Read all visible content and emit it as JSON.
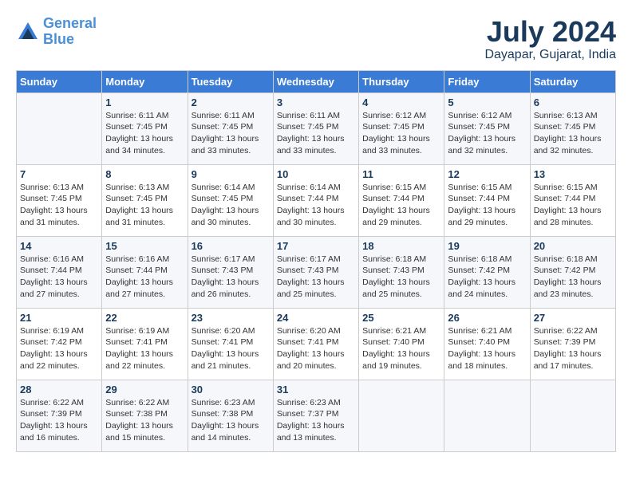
{
  "logo": {
    "line1": "General",
    "line2": "Blue"
  },
  "title": "July 2024",
  "location": "Dayapar, Gujarat, India",
  "days_of_week": [
    "Sunday",
    "Monday",
    "Tuesday",
    "Wednesday",
    "Thursday",
    "Friday",
    "Saturday"
  ],
  "weeks": [
    [
      {
        "day": "",
        "sunrise": "",
        "sunset": "",
        "daylight": ""
      },
      {
        "day": "1",
        "sunrise": "Sunrise: 6:11 AM",
        "sunset": "Sunset: 7:45 PM",
        "daylight": "Daylight: 13 hours and 34 minutes."
      },
      {
        "day": "2",
        "sunrise": "Sunrise: 6:11 AM",
        "sunset": "Sunset: 7:45 PM",
        "daylight": "Daylight: 13 hours and 33 minutes."
      },
      {
        "day": "3",
        "sunrise": "Sunrise: 6:11 AM",
        "sunset": "Sunset: 7:45 PM",
        "daylight": "Daylight: 13 hours and 33 minutes."
      },
      {
        "day": "4",
        "sunrise": "Sunrise: 6:12 AM",
        "sunset": "Sunset: 7:45 PM",
        "daylight": "Daylight: 13 hours and 33 minutes."
      },
      {
        "day": "5",
        "sunrise": "Sunrise: 6:12 AM",
        "sunset": "Sunset: 7:45 PM",
        "daylight": "Daylight: 13 hours and 32 minutes."
      },
      {
        "day": "6",
        "sunrise": "Sunrise: 6:13 AM",
        "sunset": "Sunset: 7:45 PM",
        "daylight": "Daylight: 13 hours and 32 minutes."
      }
    ],
    [
      {
        "day": "7",
        "sunrise": "Sunrise: 6:13 AM",
        "sunset": "Sunset: 7:45 PM",
        "daylight": "Daylight: 13 hours and 31 minutes."
      },
      {
        "day": "8",
        "sunrise": "Sunrise: 6:13 AM",
        "sunset": "Sunset: 7:45 PM",
        "daylight": "Daylight: 13 hours and 31 minutes."
      },
      {
        "day": "9",
        "sunrise": "Sunrise: 6:14 AM",
        "sunset": "Sunset: 7:45 PM",
        "daylight": "Daylight: 13 hours and 30 minutes."
      },
      {
        "day": "10",
        "sunrise": "Sunrise: 6:14 AM",
        "sunset": "Sunset: 7:44 PM",
        "daylight": "Daylight: 13 hours and 30 minutes."
      },
      {
        "day": "11",
        "sunrise": "Sunrise: 6:15 AM",
        "sunset": "Sunset: 7:44 PM",
        "daylight": "Daylight: 13 hours and 29 minutes."
      },
      {
        "day": "12",
        "sunrise": "Sunrise: 6:15 AM",
        "sunset": "Sunset: 7:44 PM",
        "daylight": "Daylight: 13 hours and 29 minutes."
      },
      {
        "day": "13",
        "sunrise": "Sunrise: 6:15 AM",
        "sunset": "Sunset: 7:44 PM",
        "daylight": "Daylight: 13 hours and 28 minutes."
      }
    ],
    [
      {
        "day": "14",
        "sunrise": "Sunrise: 6:16 AM",
        "sunset": "Sunset: 7:44 PM",
        "daylight": "Daylight: 13 hours and 27 minutes."
      },
      {
        "day": "15",
        "sunrise": "Sunrise: 6:16 AM",
        "sunset": "Sunset: 7:44 PM",
        "daylight": "Daylight: 13 hours and 27 minutes."
      },
      {
        "day": "16",
        "sunrise": "Sunrise: 6:17 AM",
        "sunset": "Sunset: 7:43 PM",
        "daylight": "Daylight: 13 hours and 26 minutes."
      },
      {
        "day": "17",
        "sunrise": "Sunrise: 6:17 AM",
        "sunset": "Sunset: 7:43 PM",
        "daylight": "Daylight: 13 hours and 25 minutes."
      },
      {
        "day": "18",
        "sunrise": "Sunrise: 6:18 AM",
        "sunset": "Sunset: 7:43 PM",
        "daylight": "Daylight: 13 hours and 25 minutes."
      },
      {
        "day": "19",
        "sunrise": "Sunrise: 6:18 AM",
        "sunset": "Sunset: 7:42 PM",
        "daylight": "Daylight: 13 hours and 24 minutes."
      },
      {
        "day": "20",
        "sunrise": "Sunrise: 6:18 AM",
        "sunset": "Sunset: 7:42 PM",
        "daylight": "Daylight: 13 hours and 23 minutes."
      }
    ],
    [
      {
        "day": "21",
        "sunrise": "Sunrise: 6:19 AM",
        "sunset": "Sunset: 7:42 PM",
        "daylight": "Daylight: 13 hours and 22 minutes."
      },
      {
        "day": "22",
        "sunrise": "Sunrise: 6:19 AM",
        "sunset": "Sunset: 7:41 PM",
        "daylight": "Daylight: 13 hours and 22 minutes."
      },
      {
        "day": "23",
        "sunrise": "Sunrise: 6:20 AM",
        "sunset": "Sunset: 7:41 PM",
        "daylight": "Daylight: 13 hours and 21 minutes."
      },
      {
        "day": "24",
        "sunrise": "Sunrise: 6:20 AM",
        "sunset": "Sunset: 7:41 PM",
        "daylight": "Daylight: 13 hours and 20 minutes."
      },
      {
        "day": "25",
        "sunrise": "Sunrise: 6:21 AM",
        "sunset": "Sunset: 7:40 PM",
        "daylight": "Daylight: 13 hours and 19 minutes."
      },
      {
        "day": "26",
        "sunrise": "Sunrise: 6:21 AM",
        "sunset": "Sunset: 7:40 PM",
        "daylight": "Daylight: 13 hours and 18 minutes."
      },
      {
        "day": "27",
        "sunrise": "Sunrise: 6:22 AM",
        "sunset": "Sunset: 7:39 PM",
        "daylight": "Daylight: 13 hours and 17 minutes."
      }
    ],
    [
      {
        "day": "28",
        "sunrise": "Sunrise: 6:22 AM",
        "sunset": "Sunset: 7:39 PM",
        "daylight": "Daylight: 13 hours and 16 minutes."
      },
      {
        "day": "29",
        "sunrise": "Sunrise: 6:22 AM",
        "sunset": "Sunset: 7:38 PM",
        "daylight": "Daylight: 13 hours and 15 minutes."
      },
      {
        "day": "30",
        "sunrise": "Sunrise: 6:23 AM",
        "sunset": "Sunset: 7:38 PM",
        "daylight": "Daylight: 13 hours and 14 minutes."
      },
      {
        "day": "31",
        "sunrise": "Sunrise: 6:23 AM",
        "sunset": "Sunset: 7:37 PM",
        "daylight": "Daylight: 13 hours and 13 minutes."
      },
      {
        "day": "",
        "sunrise": "",
        "sunset": "",
        "daylight": ""
      },
      {
        "day": "",
        "sunrise": "",
        "sunset": "",
        "daylight": ""
      },
      {
        "day": "",
        "sunrise": "",
        "sunset": "",
        "daylight": ""
      }
    ]
  ]
}
